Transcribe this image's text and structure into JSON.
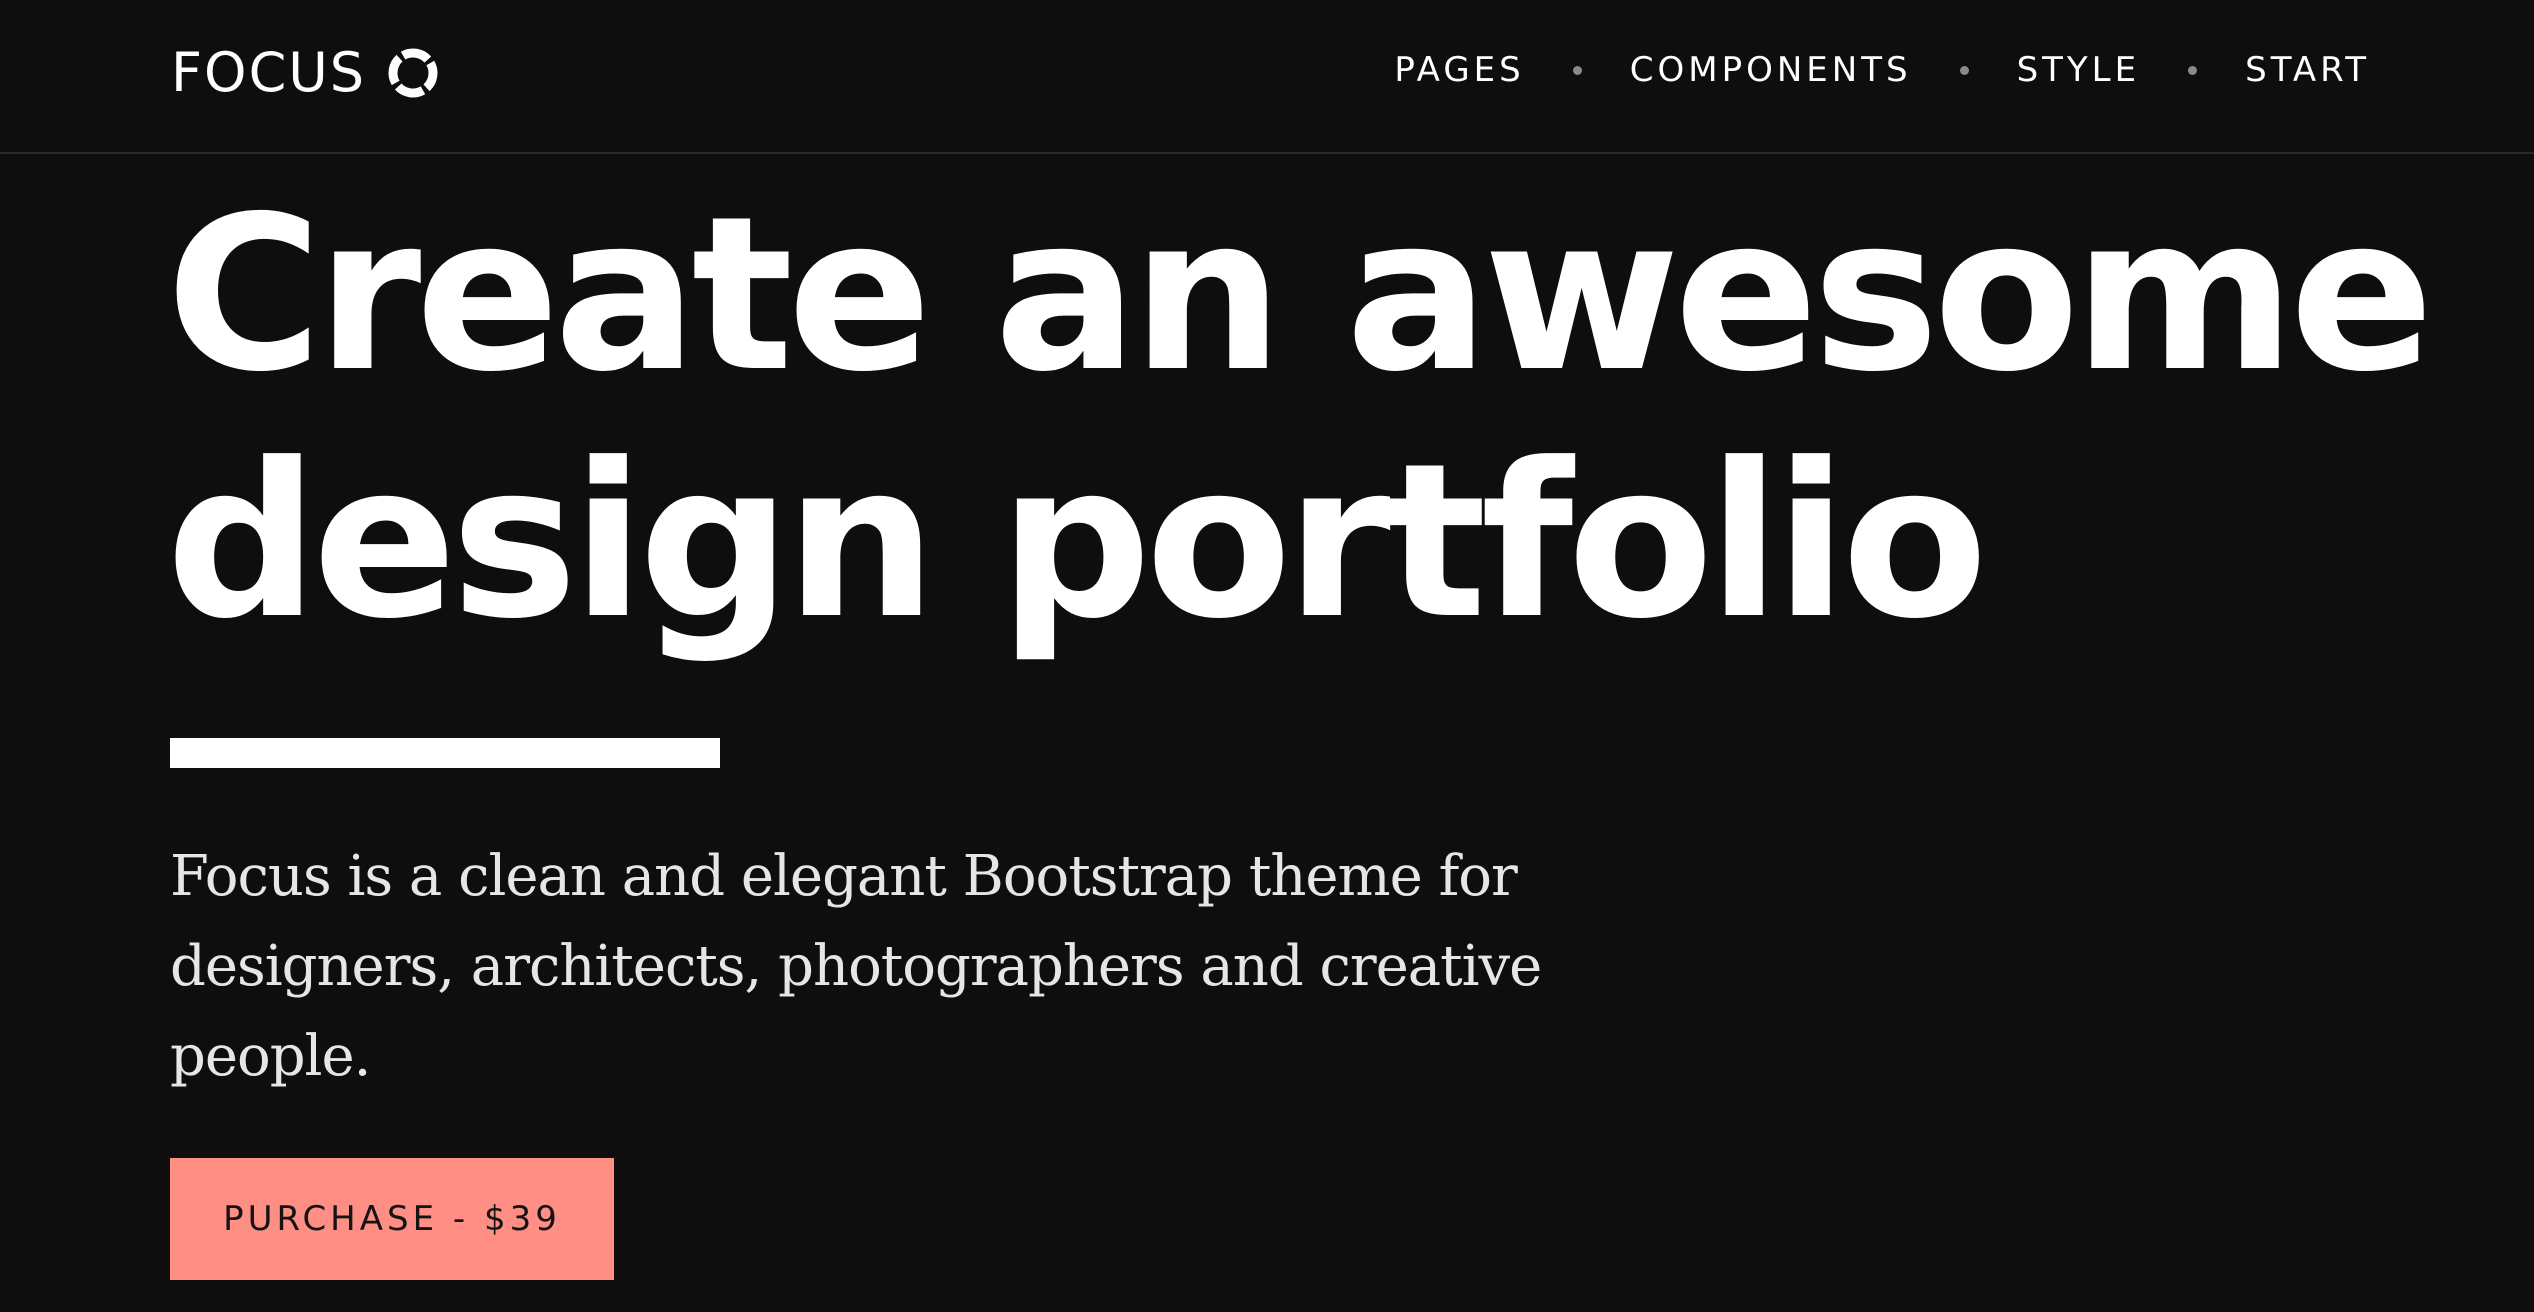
{
  "header": {
    "brand": "FOCUS",
    "brand_icon": "ring-logo-icon",
    "nav": [
      {
        "label": "PAGES"
      },
      {
        "label": "COMPONENTS"
      },
      {
        "label": "STYLE"
      },
      {
        "label": "START"
      }
    ]
  },
  "hero": {
    "title_line1": "Create an awesome",
    "title_line2": "design portfolio",
    "lead_line1": "Focus is a clean and elegant Bootstrap theme for",
    "lead_line2": "designers, architects, photographers and creative",
    "lead_line3": "people.",
    "cta_label": "PURCHASE - $39"
  },
  "colors": {
    "background": "#0e0e0e",
    "text": "#ffffff",
    "accent": "#ff8f85"
  }
}
